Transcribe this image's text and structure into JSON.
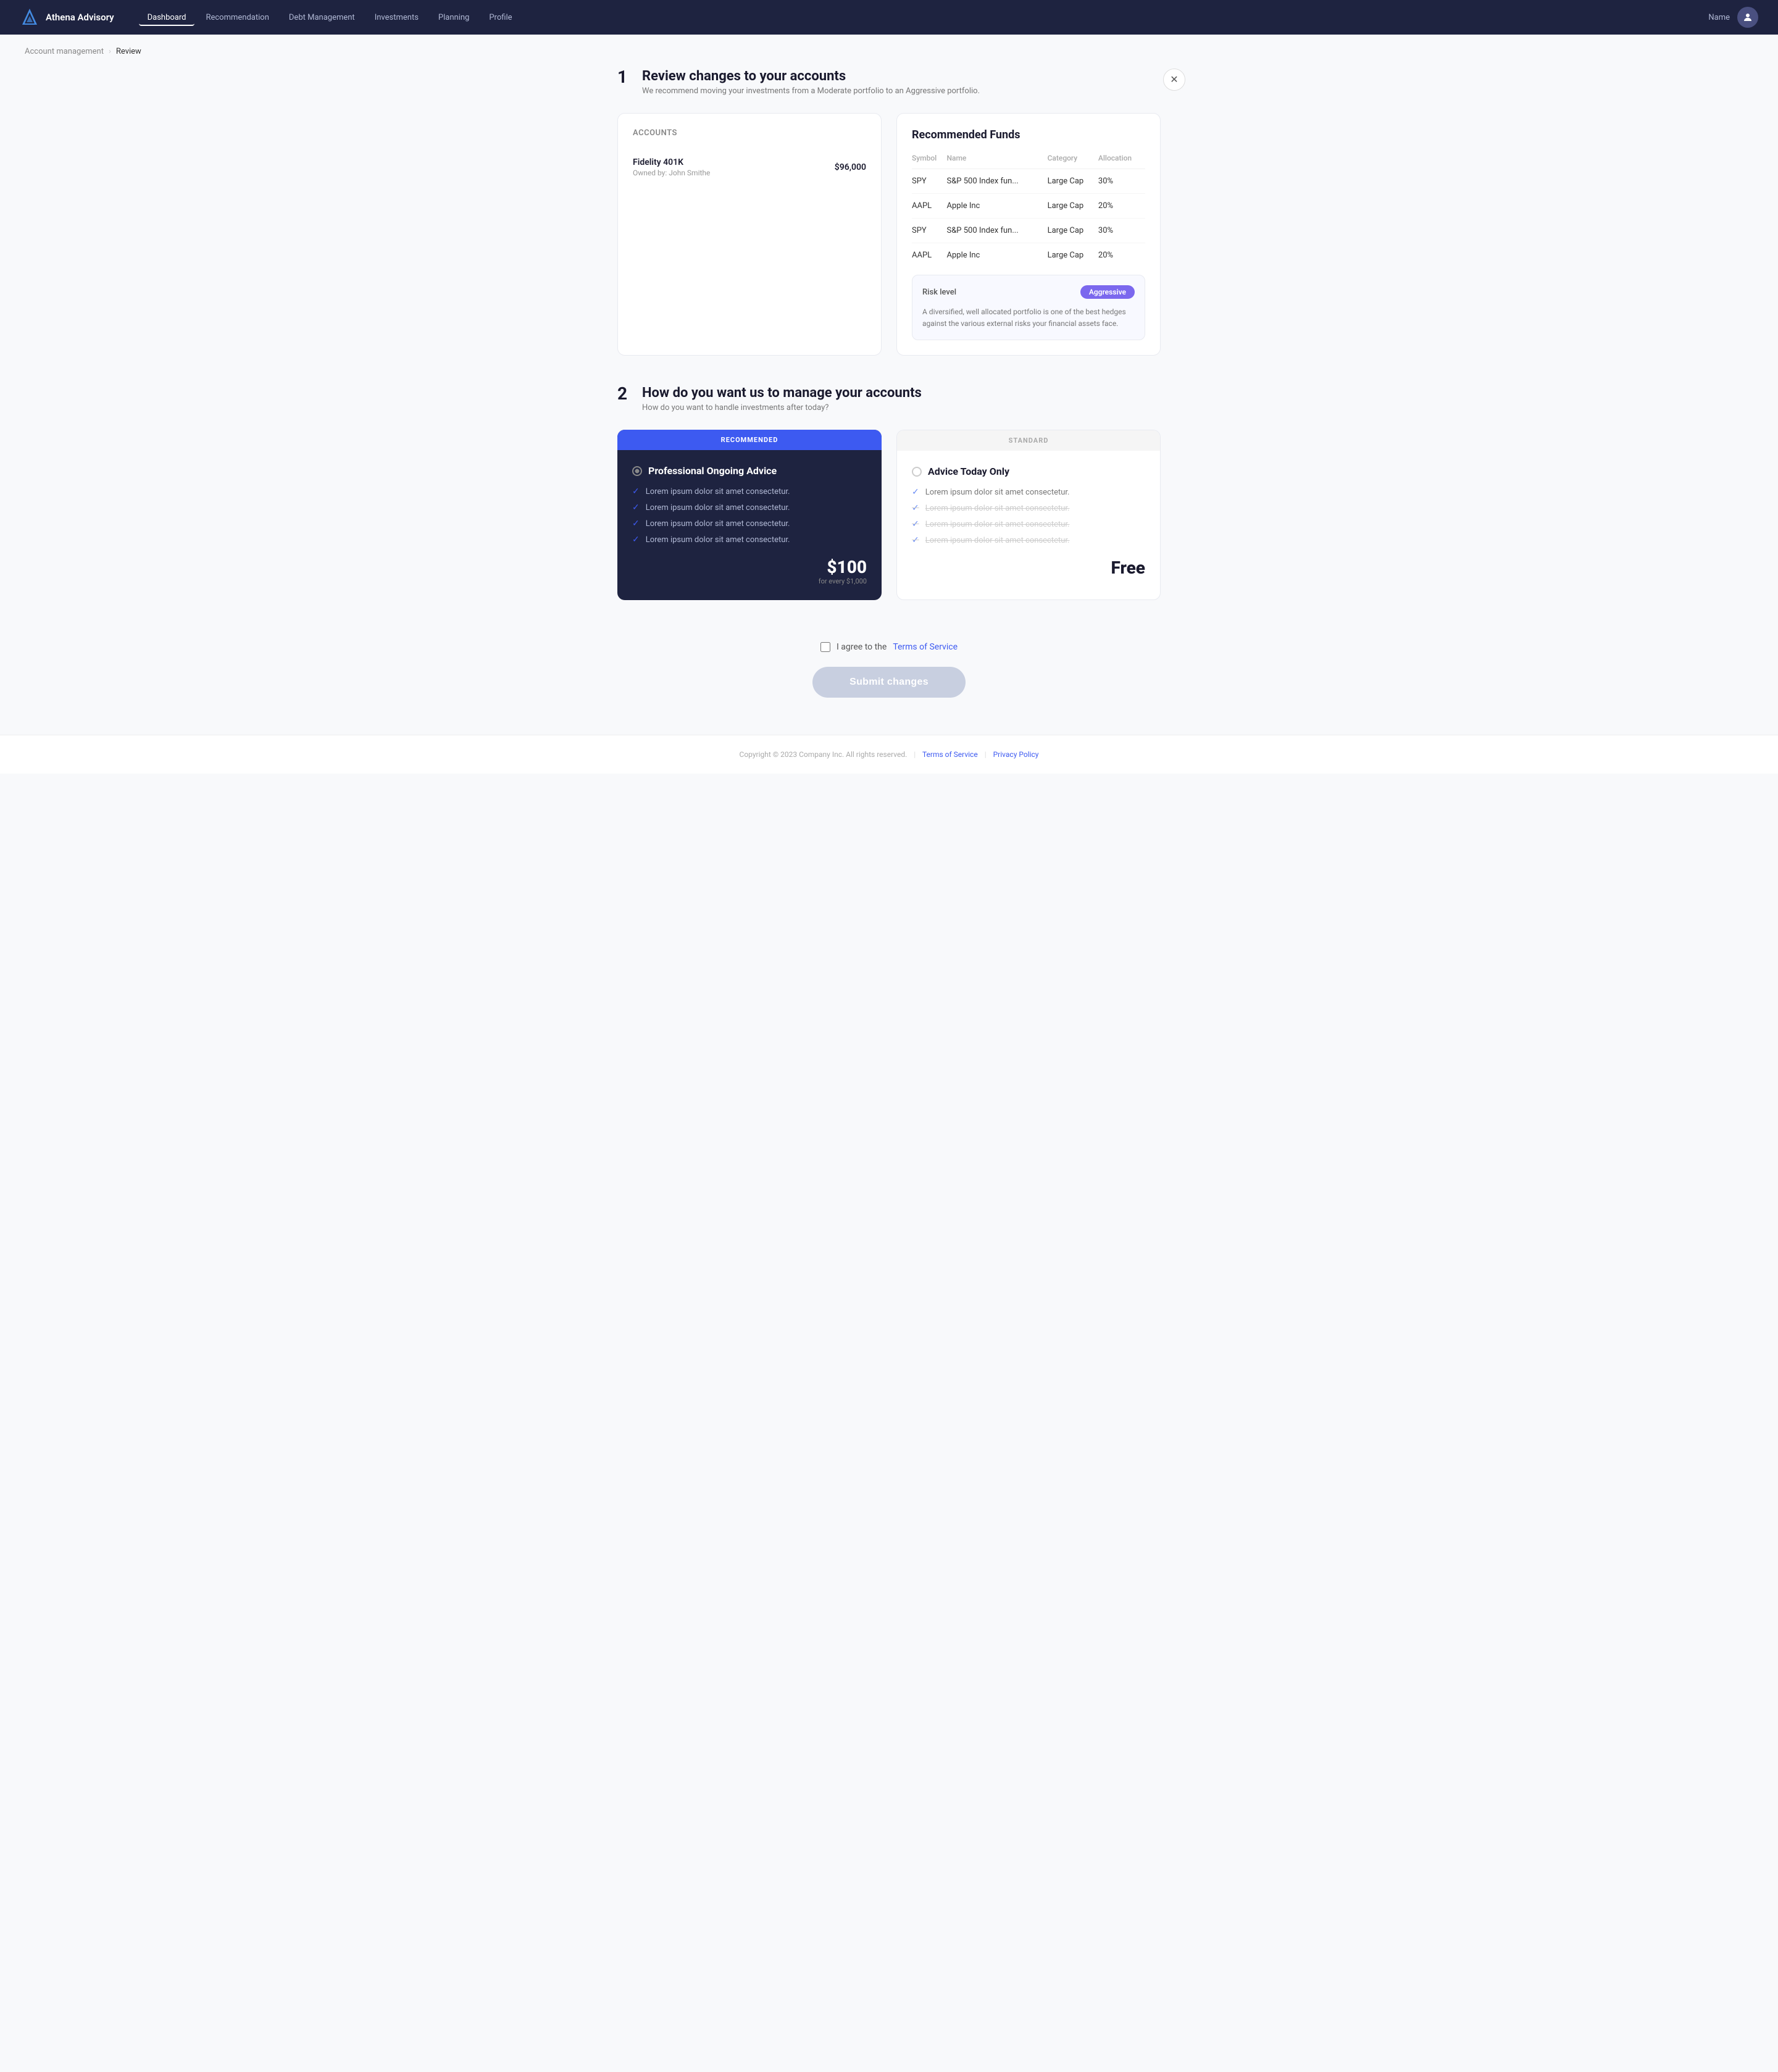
{
  "nav": {
    "logo_text": "Athena Advisory",
    "links": [
      {
        "label": "Dashboard",
        "active": true
      },
      {
        "label": "Recommendation"
      },
      {
        "label": "Debt Management"
      },
      {
        "label": "Investments"
      },
      {
        "label": "Planning"
      },
      {
        "label": "Profile"
      }
    ],
    "user_name": "Name"
  },
  "breadcrumb": {
    "parent": "Account management",
    "current": "Review"
  },
  "section1": {
    "number": "1",
    "title": "Review changes to your accounts",
    "subtitle": "We recommend moving your investments from a Moderate portfolio to an Aggressive portfolio.",
    "accounts_label": "Accounts",
    "accounts": [
      {
        "name": "Fidelity 401K",
        "owner": "Owned by: John Smithe",
        "value": "$96,000"
      }
    ],
    "funds_title": "Recommended Funds",
    "funds_columns": [
      "Symbol",
      "Name",
      "Category",
      "Allocation"
    ],
    "funds_rows": [
      {
        "symbol": "SPY",
        "name": "S&P 500 Index fun...",
        "category": "Large Cap",
        "allocation": "30%"
      },
      {
        "symbol": "AAPL",
        "name": "Apple Inc",
        "category": "Large Cap",
        "allocation": "20%"
      },
      {
        "symbol": "SPY",
        "name": "S&P 500 Index fun...",
        "category": "Large Cap",
        "allocation": "30%"
      },
      {
        "symbol": "AAPL",
        "name": "Apple Inc",
        "category": "Large Cap",
        "allocation": "20%"
      }
    ],
    "risk_label": "Risk level",
    "risk_badge": "Aggressive",
    "risk_description": "A diversified, well allocated portfolio is one of the best hedges against the various external risks your financial assets face."
  },
  "section2": {
    "number": "2",
    "title": "How do you want us to manage your accounts",
    "subtitle": "How do you want to handle investments after today?",
    "plan_recommended_badge": "RECOMMENDED",
    "plan_recommended_title": "Professional Ongoing Advice",
    "plan_recommended_features": [
      "Lorem ipsum dolor sit amet consectetur.",
      "Lorem ipsum dolor sit amet consectetur.",
      "Lorem ipsum dolor sit amet consectetur.",
      "Lorem ipsum dolor sit amet consectetur."
    ],
    "plan_recommended_price": "$100",
    "plan_recommended_price_desc": "for every $1,000",
    "plan_standard_badge": "STANDARD",
    "plan_standard_title": "Advice Today Only",
    "plan_standard_features": [
      {
        "text": "Lorem ipsum dolor sit amet consectetur.",
        "disabled": false
      },
      {
        "text": "Lorem ipsum dolor sit amet consectetur.",
        "disabled": true
      },
      {
        "text": "Lorem ipsum dolor sit amet consectetur.",
        "disabled": true
      },
      {
        "text": "Lorem ipsum dolor sit amet consectetur.",
        "disabled": true
      }
    ],
    "plan_standard_price": "Free"
  },
  "terms": {
    "agree_text": "I agree to the ",
    "tos_link": "Terms of Service",
    "submit_label": "Submit changes"
  },
  "footer": {
    "copyright": "Copyright © 2023 Company Inc. All rights reserved.",
    "tos_label": "Terms of Service",
    "privacy_label": "Privacy Policy"
  }
}
